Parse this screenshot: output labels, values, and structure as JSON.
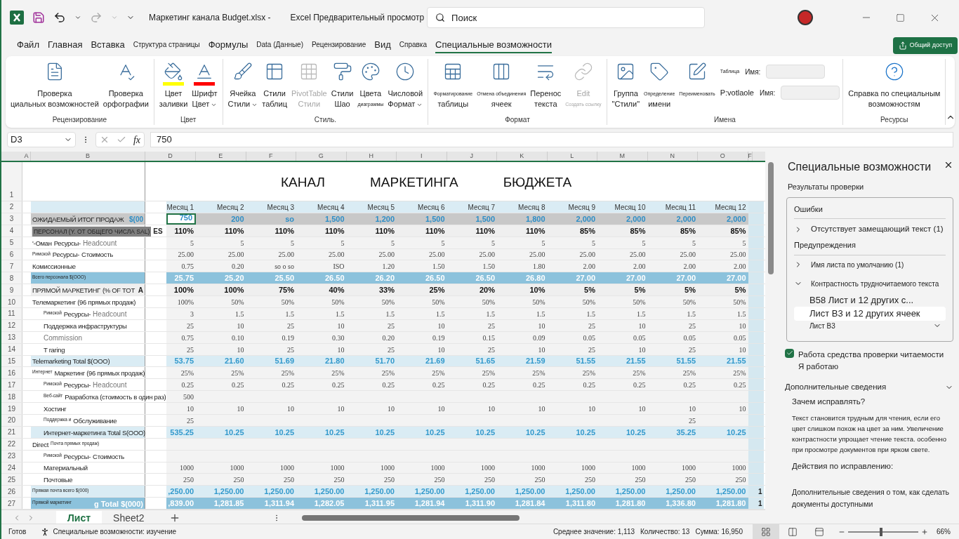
{
  "title_bar": {
    "file_name": "Маркетинг канала Budget.xlsx -",
    "app_title": "Excel Предварительный просмотр",
    "search": {
      "placeholder": "Поиск"
    }
  },
  "menu_tabs": [
    {
      "label": "Файл",
      "selected": false,
      "small": false
    },
    {
      "label": "Главная",
      "selected": false,
      "small": false
    },
    {
      "label": "Вставка",
      "selected": false,
      "small": false
    },
    {
      "label": "Структура страницы",
      "selected": false,
      "small": true
    },
    {
      "label": "Формулы",
      "selected": false,
      "small": false
    },
    {
      "label": "Data (Данные)",
      "selected": false,
      "small": true
    },
    {
      "label": "Рецензирование",
      "selected": false,
      "small": true
    },
    {
      "label": "Вид",
      "selected": false,
      "small": false
    },
    {
      "label": "Справка",
      "selected": false,
      "small": true
    },
    {
      "label": "Специальные возможности",
      "selected": true,
      "small": false
    }
  ],
  "share_button": {
    "label": "Общий доступ"
  },
  "ribbon": [
    {
      "label": "Рецензирование",
      "buttons": [
        {
          "lines": [
            {
              "text": "Проверка",
              "tiny": false
            },
            {
              "text": "циальных возможностей",
              "tiny": false
            }
          ],
          "disabled": false
        },
        {
          "lines": [
            {
              "text": "Проверка",
              "tiny": false
            },
            {
              "text": "орфографии",
              "tiny": false
            }
          ],
          "disabled": false
        }
      ]
    },
    {
      "label": "Цвет",
      "buttons": [
        {
          "lines": [
            {
              "text": "Цвет",
              "tiny": false
            },
            {
              "text": "заливки",
              "tiny": false
            }
          ],
          "disabled": false
        },
        {
          "lines": [
            {
              "text": "Шрифт",
              "tiny": false
            },
            {
              "text": "Цвет",
              "tiny": false
            }
          ],
          "disabled": false,
          "caret": true
        }
      ]
    },
    {
      "label": "Стиль.",
      "buttons": [
        {
          "lines": [
            {
              "text": "Ячейка",
              "tiny": false
            },
            {
              "text": "Стили",
              "tiny": false
            }
          ],
          "disabled": false,
          "caret": true
        },
        {
          "lines": [
            {
              "text": "Стили",
              "tiny": false
            },
            {
              "text": "таблиц",
              "tiny": false
            }
          ],
          "disabled": false
        },
        {
          "lines": [
            {
              "text": "PivotTable",
              "tiny": false
            },
            {
              "text": "Стили",
              "tiny": false
            }
          ],
          "disabled": true
        },
        {
          "lines": [
            {
              "text": "Стили",
              "tiny": false
            },
            {
              "text": "Шао",
              "tiny": false
            }
          ],
          "disabled": false
        },
        {
          "lines": [
            {
              "text": "Цвета",
              "tiny": false
            },
            {
              "text": "диаграммы",
              "tiny": true
            }
          ],
          "disabled": false
        },
        {
          "lines": [
            {
              "text": "Числовой",
              "tiny": false
            },
            {
              "text": "Формат",
              "tiny": false
            }
          ],
          "disabled": false,
          "caret": true
        }
      ]
    },
    {
      "label": "Формат",
      "buttons": [
        {
          "lines": [
            {
              "text": "Форматирование",
              "tiny": true
            },
            {
              "text": "таблицы",
              "tiny": false
            }
          ],
          "disabled": false
        },
        {
          "lines": [
            {
              "text": "Отмена объединения",
              "tiny": true
            },
            {
              "text": "ячеек",
              "tiny": false
            }
          ],
          "disabled": false
        },
        {
          "lines": [
            {
              "text": "Перенос",
              "tiny": false
            },
            {
              "text": "текста",
              "tiny": false
            }
          ],
          "disabled": false
        },
        {
          "lines": [
            {
              "text": "Edit",
              "tiny": false
            },
            {
              "text": "Создать ссылку",
              "tiny": true
            }
          ],
          "disabled": true
        }
      ]
    },
    {
      "label": "Имена",
      "buttons": [
        {
          "lines": [
            {
              "text": "Группа",
              "tiny": false
            },
            {
              "text": "\"Стили\"",
              "tiny": false
            }
          ],
          "disabled": false
        },
        {
          "lines": [
            {
              "text": "Определение",
              "tiny": true
            },
            {
              "text": "имени",
              "tiny": false
            }
          ],
          "disabled": false
        },
        {
          "lines": [
            {
              "text": "Переименовать",
              "tiny": true
            }
          ],
          "disabled": false
        }
      ],
      "fields": [
        {
          "caption": "Таблица",
          "label": "Имя:"
        },
        {
          "caption": "P:votlaole",
          "label": "Имя:"
        }
      ]
    },
    {
      "label": "Ресурсы",
      "buttons": [
        {
          "lines": [
            {
              "text": "Справка по специальным",
              "tiny": false
            },
            {
              "text": "возможностям",
              "tiny": false
            }
          ],
          "disabled": false
        }
      ]
    }
  ],
  "formula_bar": {
    "name_box": "D3",
    "function_label": "fx",
    "value": "750"
  },
  "sheet": {
    "columns": [
      "A",
      "B",
      "D",
      "E",
      "F",
      "G",
      "H",
      "I",
      "J",
      "K",
      "L",
      "M",
      "N",
      "O",
      "F"
    ],
    "title_words": [
      "КАНАЛ",
      "МАРКЕТИНГА",
      "БЮДЖЕТА"
    ],
    "rows": [
      {
        "number": "1",
        "kind": "title"
      },
      {
        "number": "2",
        "kind": "header",
        "label": [],
        "values": [
          "Месяц 1",
          "Месяц 2",
          "Месяц 3",
          "Месяц 4",
          "Месяц 5",
          "Месяц 6",
          "Месяц 7",
          "Месяц 8",
          "Месяц 9",
          "Месяц 10",
          "Месяц 11",
          "Месяц 12"
        ]
      },
      {
        "number": "3",
        "kind": "sales",
        "label": [
          {
            "text": "ОЖИДАЕМЫЙ ИТОГ ПРОДАЖ",
            "kind": "normal"
          },
          {
            "text": "$(00",
            "kind": "accent"
          }
        ],
        "values": [
          {
            "text": "750",
            "selected": true
          },
          "200",
          "so",
          "1,500",
          "1,200",
          "1,500",
          "1,500",
          "1,800",
          "2,000",
          "2,000",
          "2,000",
          "2,000"
        ]
      },
      {
        "number": "4",
        "kind": "percent",
        "label": [
          {
            "text": "ПЕРСОНАЛ (Y. ОТ ОБЩЕГО ЧИСЛА SAL)",
            "kind": "dark"
          },
          {
            "text": "ES",
            "kind": "bold"
          }
        ],
        "values": [
          "110%",
          "110%",
          "110%",
          "110%",
          "110%",
          "110%",
          "110%",
          "110%",
          "85%",
          "85%",
          "85%",
          "85%"
        ]
      },
      {
        "number": "5",
        "kind": "detail",
        "label": [
          {
            "text": "'-Оман",
            "kind": "normal"
          },
          {
            "text": "Ресурсы-",
            "kind": "normal"
          },
          {
            "text": "Headcount",
            "kind": "muted"
          }
        ],
        "values": [
          "5",
          "5",
          "5",
          "5",
          "5",
          "5",
          "5",
          "5",
          "5",
          "5",
          "5",
          "5"
        ]
      },
      {
        "number": "6",
        "kind": "detail",
        "label": [
          {
            "text": "Римской",
            "kind": "small"
          },
          {
            "text": "Ресурсы-",
            "kind": "normal"
          },
          {
            "text": "Стоимость",
            "kind": "normal"
          }
        ],
        "values": [
          "25.00",
          "25.00",
          "25.00",
          "25.00",
          "25.00",
          "25.00",
          "25.00",
          "25.00",
          "25.00",
          "25.00",
          "25.00",
          "25.00"
        ]
      },
      {
        "number": "7",
        "kind": "detail",
        "label": [
          {
            "text": "Комиссионные",
            "kind": "normal"
          }
        ],
        "values": [
          "0.75",
          "0.20",
          "so o so",
          "ISO",
          "1.20",
          "1.50",
          "1.50",
          "1.80",
          "2.00",
          "2.00",
          "2.00",
          "2.00"
        ]
      },
      {
        "number": "8",
        "kind": "total_dark",
        "label": [
          {
            "text": "Всего персонала $(OOO)",
            "kind": "small"
          }
        ],
        "values": [
          "25.75",
          "25.20",
          "25.50",
          "26.50",
          "26.20",
          "26.50",
          "26.50",
          "26.80",
          "27.00",
          "27.00",
          "27.00",
          "27.00"
        ]
      },
      {
        "number": "9",
        "kind": "percent",
        "label": [
          {
            "text": "ПРЯМОЙ МАРКЕТИНГ",
            "kind": "normal"
          },
          {
            "text": "(% OF TOT",
            "kind": "normal"
          },
          {
            "text": "A",
            "kind": "bold"
          }
        ],
        "values": [
          "100%",
          "100%",
          "75%",
          "40%",
          "33%",
          "25%",
          "20%",
          "10%",
          "5%",
          "5%",
          "5%",
          "5%"
        ]
      },
      {
        "number": "10",
        "kind": "detail",
        "label": [
          {
            "text": "Телемаркетинг (96 прямых продаж)",
            "kind": "normal"
          }
        ],
        "values": [
          "100%",
          "50%",
          "50%",
          "50%",
          "50%",
          "50%",
          "50%",
          "50%",
          "50%",
          "50%",
          "50%",
          "50%"
        ]
      },
      {
        "number": "11",
        "kind": "detail",
        "indent": true,
        "label": [
          {
            "text": "Римской",
            "kind": "small"
          },
          {
            "text": "Ресурсы-",
            "kind": "normal"
          },
          {
            "text": "Headcount",
            "kind": "muted"
          }
        ],
        "values": [
          "3",
          "1.5",
          "1.5",
          "1.5",
          "1.5",
          "1.5",
          "1.5",
          "1.5",
          "1.5",
          "1.5",
          "1.5",
          "1.5"
        ]
      },
      {
        "number": "12",
        "kind": "detail",
        "indent": true,
        "label": [
          {
            "text": "Поддержка инфраструктуры",
            "kind": "normal"
          }
        ],
        "values": [
          "25",
          "10",
          "25",
          "10",
          "25",
          "10",
          "25",
          "10",
          "25",
          "10",
          "25",
          "10"
        ]
      },
      {
        "number": "13",
        "kind": "detail",
        "indent": true,
        "label": [
          {
            "text": "Commission",
            "kind": "muted"
          }
        ],
        "values": [
          "0.75",
          "0.10",
          "0.19",
          "0.30",
          "0.20",
          "0.19",
          "0.15",
          "0.09",
          "0.05",
          "0.05",
          "0.05",
          "0.05"
        ]
      },
      {
        "number": "14",
        "kind": "detail",
        "indent": true,
        "label": [
          {
            "text": "T raring",
            "kind": "normal"
          }
        ],
        "values": [
          "25",
          "10",
          "25",
          "10",
          "25",
          "10",
          "25",
          "10",
          "25",
          "10",
          "25",
          "10"
        ]
      },
      {
        "number": "15",
        "kind": "total_light",
        "label": [
          {
            "text": "Telemarketing Total $(OOO)",
            "kind": "normal"
          }
        ],
        "values": [
          "53.75",
          "21.60",
          "51.69",
          "21.80",
          "51.70",
          "21.69",
          "51.65",
          "21.59",
          "51.55",
          "21.55",
          "51.55",
          "21.55"
        ]
      },
      {
        "number": "16",
        "kind": "detail",
        "label": [
          {
            "text": "Интернет",
            "kind": "small"
          },
          {
            "text": "Маркетинг (96 прямых продаж)",
            "kind": "normal"
          }
        ],
        "values": [
          "25%",
          "25%",
          "25%",
          "25%",
          "25%",
          "25%",
          "25%",
          "25%",
          "25%",
          "25%",
          "25%",
          "25%"
        ]
      },
      {
        "number": "17",
        "kind": "detail",
        "indent": true,
        "label": [
          {
            "text": "Римской",
            "kind": "small"
          },
          {
            "text": "Ресурсы-",
            "kind": "normal"
          },
          {
            "text": "Headcount",
            "kind": "muted"
          }
        ],
        "values": [
          "0.25",
          "0.25",
          "0.25",
          "0.25",
          "0.25",
          "0.25",
          "0.25",
          "0.25",
          "0.25",
          "0.25",
          "0.25",
          "0.25"
        ]
      },
      {
        "number": "18",
        "kind": "detail",
        "indent": true,
        "label": [
          {
            "text": "Веб-сайт",
            "kind": "small"
          },
          {
            "text": "Разработка (стоимость в один раз)",
            "kind": "normal"
          }
        ],
        "values": [
          "500",
          {
            "filled": false
          },
          {
            "filled": false
          },
          {
            "filled": false
          },
          {
            "filled": false
          },
          {
            "filled": false
          },
          {
            "filled": false
          },
          {
            "filled": false
          },
          {
            "filled": false
          },
          {
            "filled": false
          },
          {
            "filled": false
          },
          {
            "filled": false
          }
        ]
      },
      {
        "number": "19",
        "kind": "detail",
        "indent": true,
        "label": [
          {
            "text": "Хостинг",
            "kind": "normal"
          }
        ],
        "values": [
          "10",
          "10",
          "10",
          "10",
          "10",
          "10",
          "10",
          "10",
          "10",
          "10",
          "10",
          "10"
        ]
      },
      {
        "number": "20",
        "kind": "detail",
        "indent": true,
        "label": [
          {
            "text": "Поддержка и",
            "kind": "small"
          },
          {
            "text": "Обслуживание",
            "kind": "normal"
          }
        ],
        "values": [
          "25",
          {
            "filled": false
          },
          {
            "filled": false
          },
          {
            "filled": false
          },
          {
            "filled": false
          },
          {
            "filled": false
          },
          {
            "filled": false
          },
          {
            "filled": false
          },
          {
            "filled": false
          },
          {
            "filled": false
          },
          "25",
          {
            "filled": false
          }
        ]
      },
      {
        "number": "21",
        "kind": "total_light",
        "indent": true,
        "label": [
          {
            "text": "Интернет-маркетинга Total S(OOO)",
            "kind": "normal"
          }
        ],
        "values": [
          "535.25",
          "10.25",
          "10.25",
          "10.25",
          "10.25",
          "10.25",
          "10.25",
          "10.25",
          "10.25",
          "10.25",
          "35.25",
          "10.25"
        ]
      },
      {
        "number": "22",
        "kind": "detail",
        "label": [
          {
            "text": "Direct",
            "kind": "normal"
          },
          {
            "text": "Почта прямых продаж)",
            "kind": "small"
          }
        ]
      },
      {
        "number": "23",
        "kind": "detail",
        "indent": true,
        "label": [
          {
            "text": "Римской",
            "kind": "small"
          },
          {
            "text": "Ресурсы-",
            "kind": "normal"
          },
          {
            "text": "Стоимость",
            "kind": "normal"
          }
        ]
      },
      {
        "number": "24",
        "kind": "detail",
        "indent": true,
        "label": [
          {
            "text": "Материальный",
            "kind": "normal"
          }
        ],
        "values": [
          "1000",
          "1000",
          "1000",
          "1000",
          "1000",
          "1000",
          "1000",
          "1000",
          "1000",
          "1000",
          "1000",
          "1000"
        ]
      },
      {
        "number": "25",
        "kind": "detail",
        "indent": true,
        "label": [
          {
            "text": "Почтовые",
            "kind": "normal"
          }
        ],
        "values": [
          "250",
          "250",
          "250",
          "250",
          "250",
          "250",
          "250",
          "250",
          "250",
          "250",
          "250",
          "250"
        ]
      },
      {
        "number": "26",
        "kind": "total_light",
        "label": [
          {
            "text": "Прямая почта всего $(000)",
            "kind": "small"
          }
        ],
        "values": [
          ",250.00",
          "1,250.00",
          "1,250.00",
          "1,250.00",
          "1,250.00",
          "1,250.00",
          "1,250.00",
          "1,250.00",
          "1,250.00",
          "1,250.00",
          "1,250.00",
          "1,250.00"
        ],
        "edge": "1"
      },
      {
        "number": "27",
        "kind": "total_dark",
        "label": [
          {
            "text": "Прямой маркетинг",
            "kind": "small"
          },
          {
            "text": "g Total $(000)",
            "kind": "inverse"
          }
        ],
        "values": [
          ",839.00",
          "1,281.85",
          "1,311.94",
          "1,282.05",
          "1,311.95",
          "1,281.94",
          "1,311.90",
          "1,281.84",
          "1,311.80",
          "1,281.80",
          "1,336.80",
          "1,281.80"
        ],
        "edge": "1"
      }
    ]
  },
  "sheet_tabs": [
    {
      "label": "Лист",
      "selected": true
    },
    {
      "label": "Sheet2",
      "selected": false
    }
  ],
  "pane": {
    "title": "Специальные возможности",
    "results_label": "Результаты проверки",
    "sections": [
      {
        "heading": "Ошибки",
        "items": [
          {
            "label": "Отсутствует замещающий текст (1)",
            "expanded": false,
            "small": false
          }
        ]
      },
      {
        "heading": "Предупреждения",
        "items": [
          {
            "label": "Имя листа по умолчанию (1)",
            "expanded": false,
            "small": true
          },
          {
            "label": "Контрастность трудночитаемого текста",
            "expanded": true,
            "small": true,
            "children": [
              {
                "label": "B58 Лист и 12 других с...",
                "selected": false
              },
              {
                "label": "Лист B3 и 12 других ячеек",
                "selected": true
              },
              {
                "label": "Лист B3",
                "selected": false,
                "expandable": true
              }
            ]
          }
        ]
      }
    ],
    "checkbox": {
      "label": "Работа средства проверки читаемости",
      "sublabel": "Я работаю",
      "checked": true
    },
    "more_info": {
      "heading": "Дополнительные сведения",
      "why": "Зачем исправлять?",
      "text": "Текст становится трудным для чтения, если его цвет слишком похож на цвет за ним. Увеличение контрастности упрощает чтение текста. особенно при просмотре документов при ярком свете.",
      "actions": "Действия по исправлению:",
      "link": "Дополнительные сведения о том, как сделать документы доступными"
    }
  },
  "status_bar": {
    "ready": "Готов",
    "accessibility": "Специальные возможности: изучение",
    "average": "Среднее значение: 1,113",
    "count": "Количество: 13",
    "sum": "Сумма: 16,950",
    "views": [
      {
        "selected": true
      },
      {
        "selected": false
      },
      {
        "selected": false
      }
    ],
    "zoom": {
      "level": 0.45,
      "reading": "66%"
    }
  }
}
